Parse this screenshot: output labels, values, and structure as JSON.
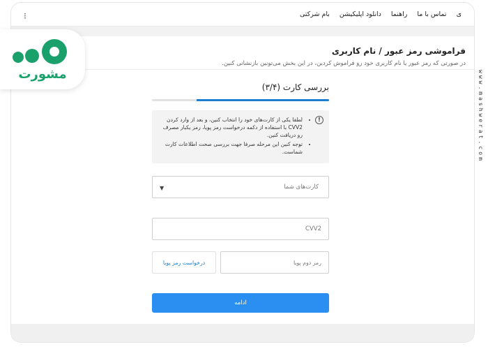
{
  "nav": {
    "items": [
      "تماس با ما",
      "راهنما",
      "دانلود اپلیکیشن",
      "بام شرکتی"
    ],
    "partial_left": "ی"
  },
  "header": {
    "title": "فراموشی رمز عبور / نام کاربری",
    "subtitle": "در صورتی که رمز عبور یا نام کاربری خود رو فراموش کردین، در این بخش می‌تونین بازنشانی کنین."
  },
  "step": {
    "title": "بررسی کارت (۳/۴)",
    "progress": 0.75,
    "accent": "#1a7fd0"
  },
  "info": {
    "icon": "!",
    "bullets": [
      "لطفا یکی از کارت‌های خود را انتخاب کنین، و بعد از وارد کردن CVV2 با استفاده از دکمه درخواست رمز پویا، رمز یکبار مصرف رو دریافت کنین.",
      "توجه کنین این مرحله صرفا جهت بررسی صحت اطلاعات کارت شماست."
    ]
  },
  "form": {
    "card_select_placeholder": "کارت‌های شما",
    "cvv_placeholder": "CVV2",
    "otp_placeholder": "رمز دوم پویا",
    "otp_button": "درخواست رمز پویا",
    "continue_button": "ادامه"
  },
  "branding": {
    "logo_text": "مشورت",
    "logo_color": "#19a06b",
    "watermark": "www.mashwerat.com"
  },
  "colors": {
    "primary_button": "#2a8ff0",
    "link": "#1a7fd0"
  }
}
